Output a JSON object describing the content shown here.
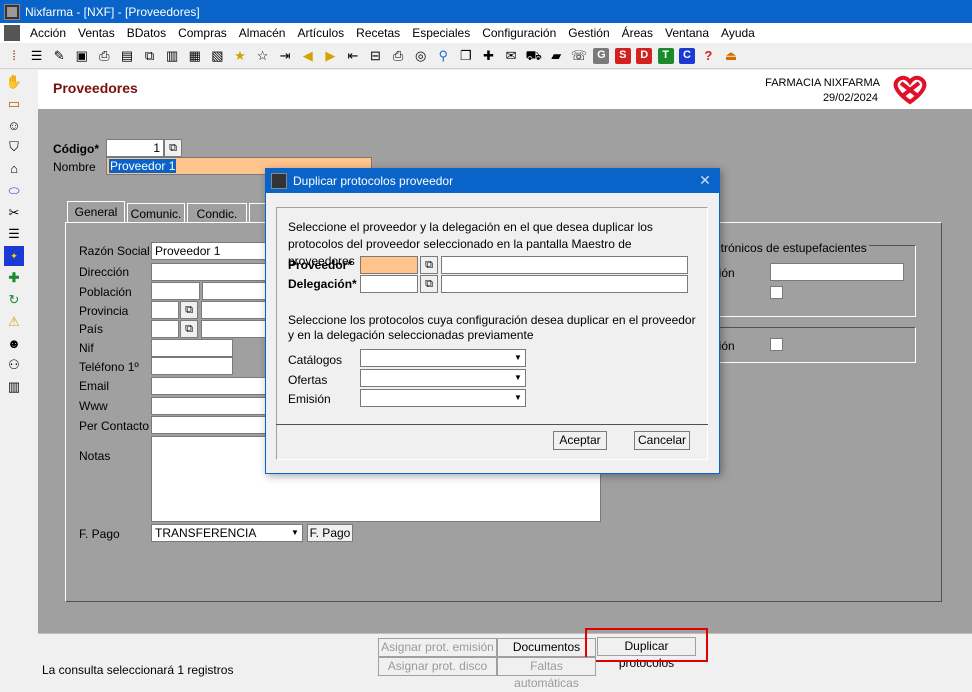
{
  "window": {
    "title": "Nixfarma - [NXF] - [Proveedores]"
  },
  "menubar": {
    "items": [
      "Acción",
      "Ventas",
      "BDatos",
      "Compras",
      "Almacén",
      "Artículos",
      "Recetas",
      "Especiales",
      "Configuración",
      "Gestión",
      "Áreas",
      "Ventana",
      "Ayuda"
    ]
  },
  "toolbar": {
    "icons": [
      "tool-a-icon",
      "list-icon",
      "edit-icon",
      "box-icon",
      "print-icon",
      "doc-icon",
      "copy-icon",
      "clipboard-icon",
      "paste-icon",
      "doc2-icon",
      "star-icon",
      "star-outline-icon",
      "export-icon",
      "arrow-left-icon",
      "arrow-right-icon",
      "import-icon",
      "lock-icon",
      "print2-icon",
      "globe-icon",
      "map-pin-icon",
      "window-icon",
      "cross-icon",
      "chat-icon",
      "cart-icon",
      "folder-icon",
      "phone-icon"
    ],
    "letters": [
      {
        "label": "G",
        "color": "#7a7a7a"
      },
      {
        "label": "S",
        "color": "#d32020"
      },
      {
        "label": "D",
        "color": "#d32020"
      },
      {
        "label": "T",
        "color": "#1a8a2a"
      },
      {
        "label": "C",
        "color": "#1a3ad3"
      }
    ],
    "help": "?",
    "last_icon": "exit-icon"
  },
  "sidebar": {
    "icons": [
      "hand-icon",
      "ticket-icon",
      "person-icon",
      "basket-icon",
      "factory-icon",
      "pill-icon",
      "tools-icon",
      "stack-icon",
      "eu-icon",
      "plus-icon",
      "refresh-icon",
      "warning-icon",
      "users-icon",
      "network-icon",
      "barcode-icon"
    ]
  },
  "header": {
    "title": "Proveedores",
    "company": "FARMACIA NIXFARMA",
    "date": "29/02/2024"
  },
  "form": {
    "codigo_label": "Código*",
    "codigo_value": "1",
    "nombre_label": "Nombre",
    "nombre_value": "Proveedor 1",
    "tabs": [
      "General",
      "Comunic.",
      "Condic."
    ],
    "razon_social_label": "Razón Social",
    "razon_social_value": "Proveedor 1",
    "direccion_label": "Dirección",
    "poblacion_label": "Población",
    "provincia_label": "Provincia",
    "pais_label": "País",
    "nif_label": "Nif",
    "telefono_label": "Teléfono 1º",
    "email_label": "Email",
    "www_label": "Www",
    "per_contacto_label": "Per Contacto",
    "notas_label": "Notas",
    "fpago_label": "F. Pago",
    "fpago_value": "TRANSFERENCIA",
    "fpago_button": "F. Pago",
    "estupefacientes_group": "ectrónicos de estupefacientes",
    "ación_label": "ación",
    "pcion_label": "pción"
  },
  "dialog": {
    "title": "Duplicar protocolos proveedor",
    "intro": "Seleccione  el proveedor y la delegación en el que desea duplicar los protocolos del proveedor seleccionado en la pantalla Maestro de proveedores",
    "proveedor_label": "Proveedor*",
    "delegacion_label": "Delegación*",
    "protocols_text": "Seleccione los protocolos cuya configuración desea duplicar en el proveedor y en la delegación seleccionadas previamente",
    "catalogos_label": "Catálogos",
    "ofertas_label": "Ofertas",
    "emision_label": "Emisión",
    "accept": "Aceptar",
    "cancel": "Cancelar"
  },
  "bottom": {
    "asignar_emision": "Asignar prot. emisión",
    "documentos": "Documentos",
    "duplicar": "Duplicar protocolos",
    "asignar_disco": "Asignar prot. disco",
    "faltas": "Faltas automáticas",
    "status": "La consulta seleccionará 1  registros"
  },
  "colors": {
    "titlebar": "#0a63c9",
    "highlight": "#ffc48c",
    "page_title": "#7a1010",
    "emphasis_box": "#e00000"
  }
}
